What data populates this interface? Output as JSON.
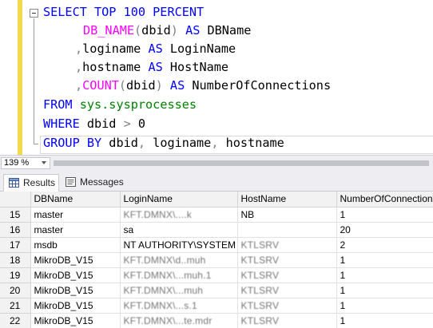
{
  "editor": {
    "lines": [
      {
        "segments": [
          [
            "kw",
            "SELECT TOP 100 PERCENT"
          ]
        ]
      },
      {
        "segments": [
          [
            "fn",
            "DB_NAME"
          ],
          [
            "gr",
            "("
          ],
          [
            "plain",
            "dbid"
          ],
          [
            "gr",
            ")"
          ],
          [
            "plain",
            " "
          ],
          [
            "kw",
            "AS"
          ],
          [
            "plain",
            " DBName"
          ]
        ]
      },
      {
        "segments": [
          [
            "gr",
            ","
          ],
          [
            "plain",
            "loginame "
          ],
          [
            "kw",
            "AS"
          ],
          [
            "plain",
            " LoginName"
          ]
        ]
      },
      {
        "segments": [
          [
            "gr",
            ","
          ],
          [
            "plain",
            "hostname "
          ],
          [
            "kw",
            "AS"
          ],
          [
            "plain",
            " HostName"
          ]
        ]
      },
      {
        "segments": [
          [
            "gr",
            ","
          ],
          [
            "fn",
            "COUNT"
          ],
          [
            "gr",
            "("
          ],
          [
            "plain",
            "dbid"
          ],
          [
            "gr",
            ")"
          ],
          [
            "plain",
            " "
          ],
          [
            "kw",
            "AS"
          ],
          [
            "plain",
            " NumberOfConnections"
          ]
        ]
      },
      {
        "segments": [
          [
            "kw",
            "FROM"
          ],
          [
            "plain",
            " "
          ],
          [
            "obj",
            "sys.sysprocesses"
          ]
        ]
      },
      {
        "segments": [
          [
            "kw",
            "WHERE"
          ],
          [
            "plain",
            " dbid "
          ],
          [
            "gr",
            ">"
          ],
          [
            "plain",
            " 0"
          ]
        ]
      },
      {
        "segments": [
          [
            "kw",
            "GROUP BY"
          ],
          [
            "plain",
            " dbid"
          ],
          [
            "gr",
            ","
          ],
          [
            "plain",
            " loginame"
          ],
          [
            "gr",
            ","
          ],
          [
            "plain",
            " hostname"
          ]
        ]
      }
    ]
  },
  "zoom": {
    "value": "139 %"
  },
  "tabs": [
    {
      "label": "Results",
      "icon": "grid-icon",
      "active": true
    },
    {
      "label": "Messages",
      "icon": "messages-icon",
      "active": false
    }
  ],
  "grid": {
    "columns": [
      "DBName",
      "LoginName",
      "HostName",
      "NumberOfConnections"
    ],
    "rows": [
      {
        "num": "15",
        "cells": [
          "master",
          "KFT.DMNX\\....k",
          "NB",
          "1"
        ],
        "blurred": [
          1
        ]
      },
      {
        "num": "16",
        "cells": [
          "master",
          "sa",
          "",
          "20"
        ],
        "blurred": []
      },
      {
        "num": "17",
        "cells": [
          "msdb",
          "NT AUTHORITY\\SYSTEM",
          "KTLSRV",
          "2"
        ],
        "blurred": [
          2
        ]
      },
      {
        "num": "18",
        "cells": [
          "MikroDB_V15",
          "KFT.DMNX\\d..muh",
          "KTLSRV",
          "1"
        ],
        "blurred": [
          1,
          2
        ]
      },
      {
        "num": "19",
        "cells": [
          "MikroDB_V15",
          "KFT.DMNX\\...muh.1",
          "KTLSRV",
          "1"
        ],
        "blurred": [
          1,
          2
        ]
      },
      {
        "num": "20",
        "cells": [
          "MikroDB_V15",
          "KFT.DMNX\\...muh",
          "KTLSRV",
          "1"
        ],
        "blurred": [
          1,
          2
        ]
      },
      {
        "num": "21",
        "cells": [
          "MikroDB_V15",
          "KFT.DMNX\\...s.1",
          "KTLSRV",
          "1"
        ],
        "blurred": [
          1,
          2
        ]
      },
      {
        "num": "22",
        "cells": [
          "MikroDB_V15",
          "KFT.DMNX\\...te.mdr",
          "KTLSRV",
          "1"
        ],
        "blurred": [
          1,
          2
        ]
      }
    ]
  }
}
